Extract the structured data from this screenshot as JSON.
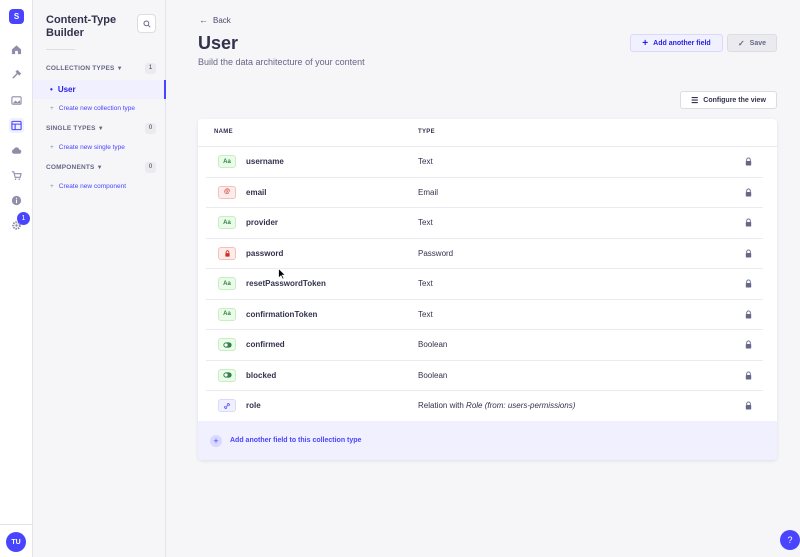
{
  "rail": {
    "logo_text": "S",
    "settings_badge": "1",
    "avatar_initials": "TU",
    "items": [
      {
        "name": "home-icon"
      },
      {
        "name": "content-manager-icon"
      },
      {
        "name": "media-library-icon"
      },
      {
        "name": "content-type-builder-icon",
        "active": true
      },
      {
        "name": "cloud-icon"
      },
      {
        "name": "marketplace-icon"
      },
      {
        "name": "info-icon"
      },
      {
        "name": "settings-icon"
      }
    ]
  },
  "subnav": {
    "title": "Content-Type Builder",
    "sections": [
      {
        "label": "COLLECTION TYPES",
        "count": "1"
      },
      {
        "label": "SINGLE TYPES",
        "count": "0"
      },
      {
        "label": "COMPONENTS",
        "count": "0"
      }
    ],
    "active_item": "User",
    "create_collection": "Create new collection type",
    "create_single": "Create new single type",
    "create_component": "Create new component"
  },
  "header": {
    "back_label": "Back",
    "title": "User",
    "subtitle": "Build the data architecture of your content",
    "add_field_label": "Add another field",
    "save_label": "Save",
    "configure_label": "Configure the view"
  },
  "table": {
    "col_name": "NAME",
    "col_type": "TYPE",
    "rows": [
      {
        "name": "username",
        "type": "Text",
        "icon": "text-icon",
        "icon_text": "Aa"
      },
      {
        "name": "email",
        "type": "Email",
        "icon": "email-icon",
        "icon_text": "@"
      },
      {
        "name": "provider",
        "type": "Text",
        "icon": "text-icon",
        "icon_text": "Aa"
      },
      {
        "name": "password",
        "type": "Password",
        "icon": "password-icon",
        "icon_text": ""
      },
      {
        "name": "resetPasswordToken",
        "type": "Text",
        "icon": "text-icon",
        "icon_text": "Aa"
      },
      {
        "name": "confirmationToken",
        "type": "Text",
        "icon": "text-icon",
        "icon_text": "Aa"
      },
      {
        "name": "confirmed",
        "type": "Boolean",
        "icon": "boolean-icon",
        "icon_text": ""
      },
      {
        "name": "blocked",
        "type": "Boolean",
        "icon": "boolean-icon",
        "icon_text": ""
      },
      {
        "name": "role",
        "type": "Relation with",
        "type_em": "Role (from: users-permissions)",
        "icon": "relation-icon",
        "icon_text": ""
      }
    ],
    "add_footer_label": "Add another field to this collection type"
  },
  "colors": {
    "accent": "#4945ff",
    "background": "#f6f6f9"
  }
}
